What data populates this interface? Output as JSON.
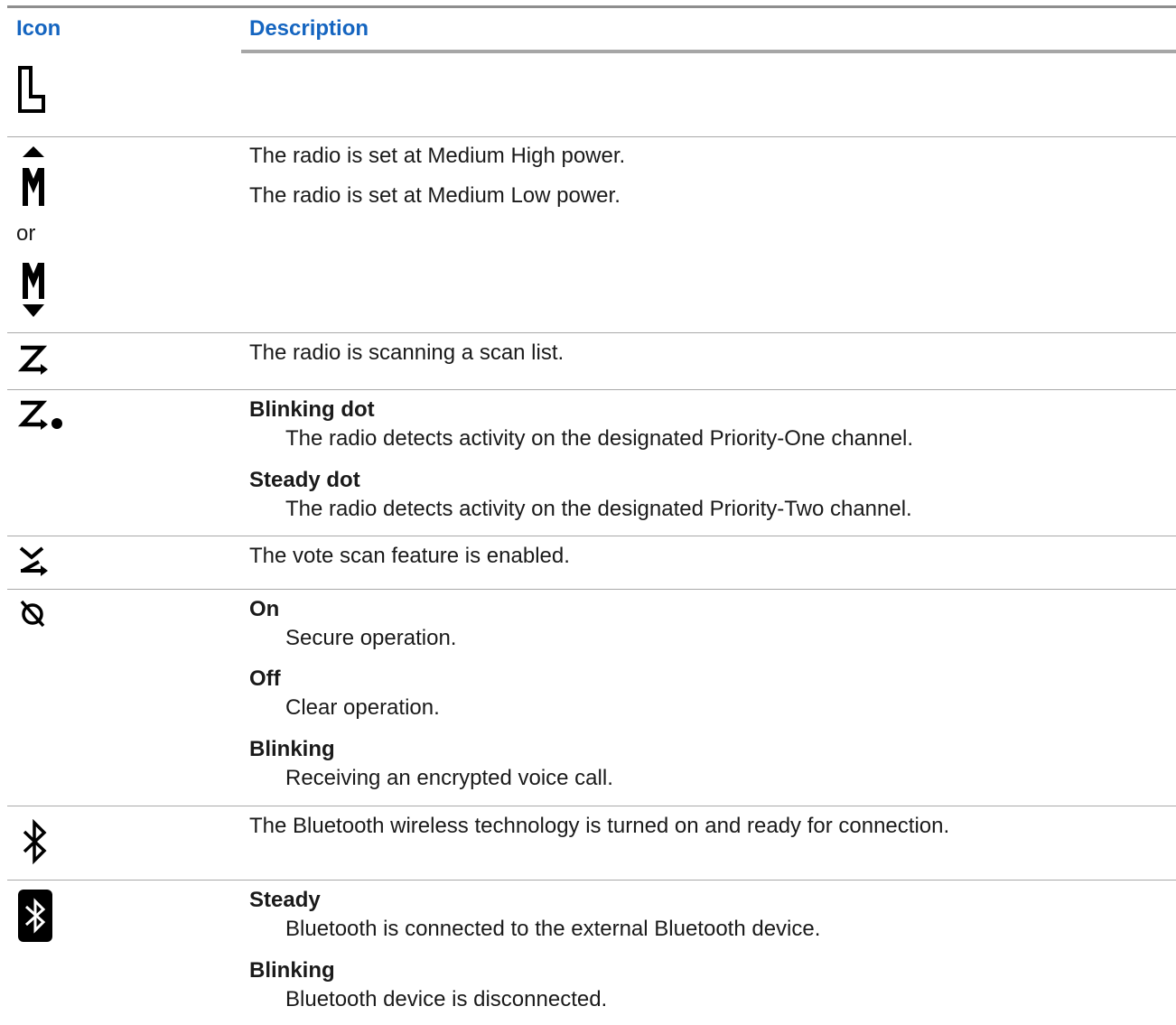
{
  "header": {
    "icon_label": "Icon",
    "description_label": "Description"
  },
  "rows": [
    {
      "icon": "low-power-icon"
    },
    {
      "icons": [
        "medium-high-power-icon",
        "medium-low-power-icon"
      ],
      "or_label": "or",
      "lines": [
        "The radio is set at Medium High power.",
        "The radio is set at Medium Low power."
      ]
    },
    {
      "icon": "scan-icon",
      "lines": [
        "The radio is scanning a scan list."
      ]
    },
    {
      "icon": "priority-scan-icon",
      "terms": [
        {
          "term": "Blinking dot",
          "definition": "The radio detects activity on the designated Priority-One channel."
        },
        {
          "term": "Steady dot",
          "definition": "The radio detects activity on the designated Priority-Two channel."
        }
      ]
    },
    {
      "icon": "vote-scan-icon",
      "lines": [
        "The vote scan feature is enabled."
      ]
    },
    {
      "icon": "secure-operation-icon",
      "terms": [
        {
          "term": "On",
          "definition": "Secure operation."
        },
        {
          "term": "Off",
          "definition": "Clear operation."
        },
        {
          "term": "Blinking",
          "definition": "Receiving an encrypted voice call."
        }
      ]
    },
    {
      "icon": "bluetooth-icon",
      "lines": [
        "The Bluetooth wireless technology is turned on and ready for connection."
      ]
    },
    {
      "icon": "bluetooth-connected-icon",
      "terms": [
        {
          "term": "Steady",
          "definition": "Bluetooth is connected to the external Bluetooth device."
        },
        {
          "term": "Blinking",
          "definition": "Bluetooth device is disconnected."
        }
      ]
    }
  ]
}
